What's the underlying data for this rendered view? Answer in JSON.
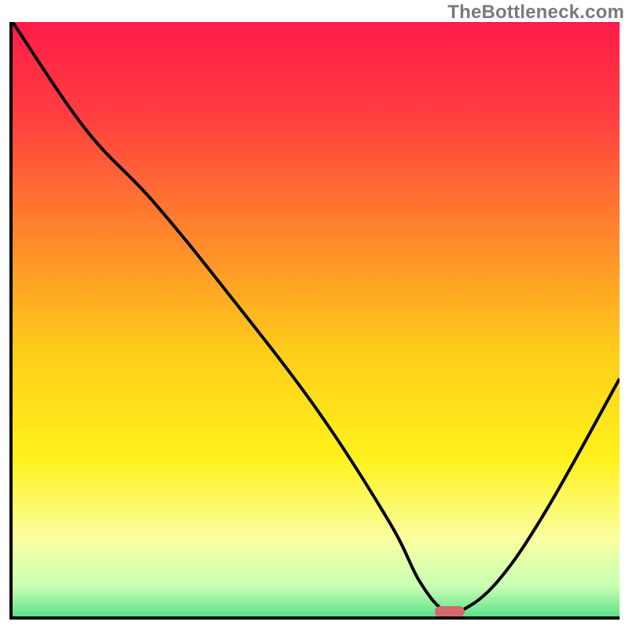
{
  "watermark": "TheBottleneck.com",
  "chart_data": {
    "type": "line",
    "title": "",
    "xlabel": "",
    "ylabel": "",
    "xlim": [
      0,
      100
    ],
    "ylim": [
      0,
      100
    ],
    "grid": false,
    "legend": false,
    "gradient_stops": [
      {
        "offset": 0,
        "color": "#ff1b49"
      },
      {
        "offset": 0.16,
        "color": "#ff4040"
      },
      {
        "offset": 0.36,
        "color": "#ff8a2b"
      },
      {
        "offset": 0.55,
        "color": "#ffcf1a"
      },
      {
        "offset": 0.72,
        "color": "#fff21c"
      },
      {
        "offset": 0.85,
        "color": "#fbffa0"
      },
      {
        "offset": 0.93,
        "color": "#c8ffb3"
      },
      {
        "offset": 0.975,
        "color": "#67e48f"
      },
      {
        "offset": 1.0,
        "color": "#1fd36f"
      }
    ],
    "series": [
      {
        "name": "bottleneck-curve",
        "x": [
          0,
          12,
          23,
          35,
          50,
          62,
          67,
          71,
          74,
          80,
          88,
          100
        ],
        "y": [
          100,
          82,
          70,
          55,
          35,
          16,
          6,
          1,
          1,
          6,
          18,
          40
        ]
      }
    ],
    "marker": {
      "name": "optimal-point",
      "x": 72,
      "y": 0.8,
      "color": "#d26a6d"
    }
  }
}
